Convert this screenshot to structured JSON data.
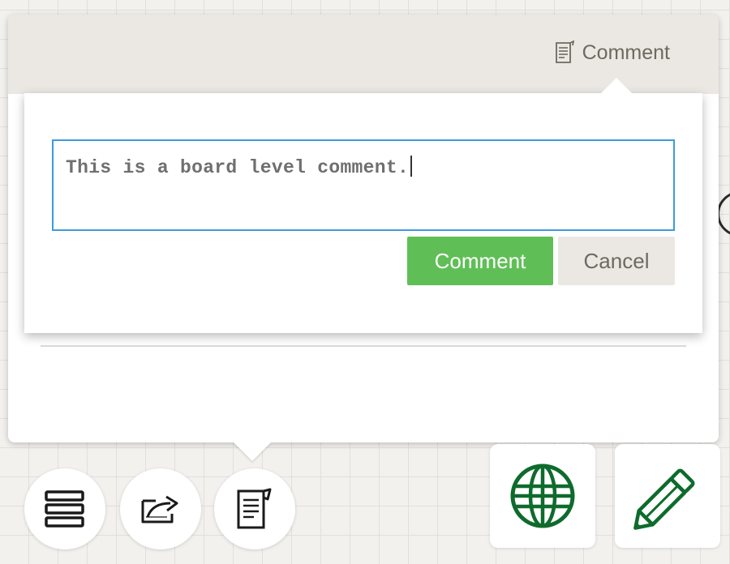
{
  "header": {
    "comment_label": "Comment",
    "comment_icon": "comment-doc-icon"
  },
  "comment_form": {
    "input_value": "This is a board level comment.",
    "submit_label": "Comment",
    "cancel_label": "Cancel"
  },
  "toolbar": {
    "items": [
      {
        "icon": "list-icon"
      },
      {
        "icon": "share-icon"
      },
      {
        "icon": "comment-doc-icon"
      }
    ],
    "right_items": [
      {
        "icon": "globe-icon"
      },
      {
        "icon": "pencil-icon"
      }
    ]
  },
  "colors": {
    "accent_green": "#5fbf56",
    "input_border": "#3d9bdc",
    "header_bg": "#ebe8e4",
    "icon_green": "#0e6b2c"
  }
}
